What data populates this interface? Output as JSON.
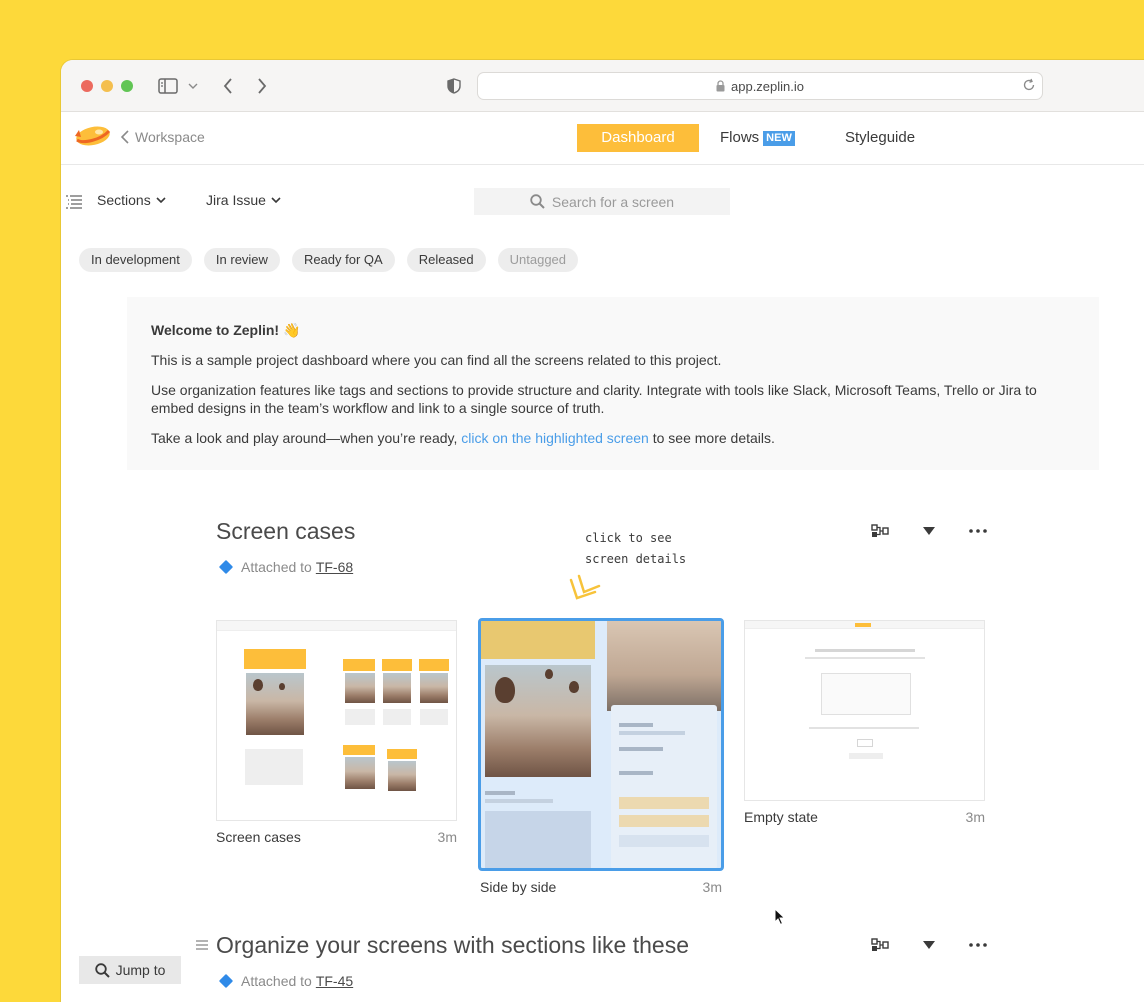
{
  "browser": {
    "url": "app.zeplin.io"
  },
  "header": {
    "back_label": "Workspace",
    "tabs": [
      {
        "label": "Dashboard",
        "active": true
      },
      {
        "label": "Flows",
        "badge": "NEW"
      },
      {
        "label": "Styleguide"
      }
    ]
  },
  "toolbar": {
    "sections_label": "Sections",
    "jira_label": "Jira Issue",
    "search_placeholder": "Search for a screen"
  },
  "tags": [
    "In development",
    "In review",
    "Ready for QA",
    "Released",
    "Untagged"
  ],
  "welcome": {
    "title": "Welcome to Zeplin! 👋",
    "line1": "This is a sample project dashboard where you can find all the screens related to this project.",
    "line2": "Use organization features like tags and sections to provide structure and clarity. Integrate with tools like Slack, Microsoft Teams, Trello or Jira to embed designs in the team’s workflow and link to a single source of truth.",
    "line3_prefix": "Take a look and play around—when you’re ready, ",
    "line3_link": "click on the highlighted screen",
    "line3_suffix": " to see more details."
  },
  "section1": {
    "title": "Screen cases",
    "attached_prefix": "Attached to",
    "attached_key": "TF-68",
    "annotation_line1": "click to see",
    "annotation_line2": "screen details",
    "screens": [
      {
        "name": "Screen cases",
        "time": "3m"
      },
      {
        "name": "Side by side",
        "time": "3m",
        "selected": true
      },
      {
        "name": "Empty state",
        "time": "3m"
      }
    ]
  },
  "section2": {
    "title": "Organize your screens with sections like these",
    "attached_prefix": "Attached to",
    "attached_key": "TF-45"
  },
  "jump_to_label": "Jump to",
  "colors": {
    "background": "#FDD93A",
    "accent": "#FDBE3A",
    "link": "#4A9DE8"
  }
}
